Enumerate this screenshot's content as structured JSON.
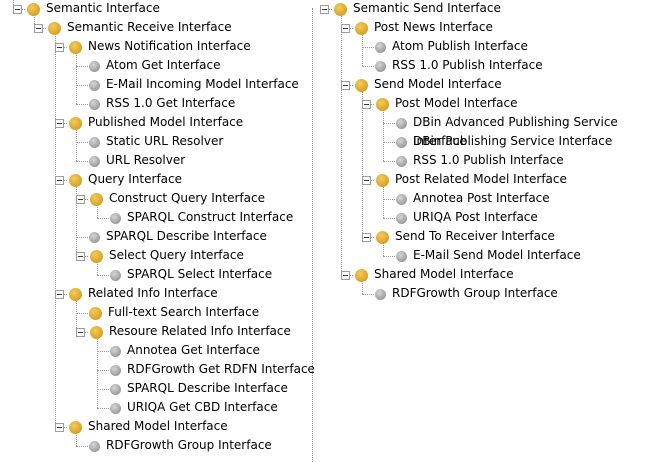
{
  "tree": {
    "left": {
      "label": "Semantic Interface",
      "children": [
        {
          "label": "Semantic Receive Interface",
          "children": [
            {
              "label": "News Notification Interface",
              "children": [
                {
                  "label": "Atom Get Interface"
                },
                {
                  "label": "E-Mail Incoming Model Interface"
                },
                {
                  "label": "RSS 1.0 Get Interface"
                }
              ]
            },
            {
              "label": "Published Model Interface",
              "children": [
                {
                  "label": "Static URL Resolver"
                },
                {
                  "label": "URL Resolver"
                }
              ]
            },
            {
              "label": "Query Interface",
              "children": [
                {
                  "label": "Construct Query Interface",
                  "children": [
                    {
                      "label": "SPARQL Construct Interface"
                    }
                  ]
                },
                {
                  "label": "SPARQL Describe Interface"
                },
                {
                  "label": "Select Query Interface",
                  "children": [
                    {
                      "label": "SPARQL Select Interface"
                    }
                  ]
                }
              ]
            },
            {
              "label": "Related Info Interface",
              "children": [
                {
                  "label": "Full-text Search Interface",
                  "icon": "branch"
                },
                {
                  "label": "Resoure Related Info Interface",
                  "children": [
                    {
                      "label": "Annotea Get Interface"
                    },
                    {
                      "label": "RDFGrowth Get RDFN Interface"
                    },
                    {
                      "label": "SPARQL Describe Interface"
                    },
                    {
                      "label": "URIQA Get CBD Interface"
                    }
                  ]
                }
              ]
            },
            {
              "label": "Shared Model Interface",
              "children": [
                {
                  "label": "RDFGrowth Group Interface"
                }
              ]
            }
          ]
        }
      ]
    },
    "right": {
      "label": "Semantic Send Interface",
      "children": [
        {
          "label": "Post News Interface",
          "children": [
            {
              "label": "Atom Publish Interface"
            },
            {
              "label": "RSS 1.0 Publish Interface"
            }
          ]
        },
        {
          "label": "Send Model Interface",
          "children": [
            {
              "label": "Post Model Interface",
              "children": [
                {
                  "label": "DBin Advanced Publishing Service Interface"
                },
                {
                  "label": "DBin Publishing Service Interface"
                },
                {
                  "label": "RSS 1.0 Publish Interface"
                }
              ]
            },
            {
              "label": "Post Related Model Interface",
              "children": [
                {
                  "label": "Annotea Post Interface"
                },
                {
                  "label": "URIQA Post Interface"
                }
              ]
            },
            {
              "label": "Send To Receiver Interface",
              "children": [
                {
                  "label": "E-Mail Send Model Interface"
                }
              ]
            }
          ]
        },
        {
          "label": "Shared Model Interface",
          "children": [
            {
              "label": "RDFGrowth Group Interface"
            }
          ]
        }
      ]
    }
  },
  "icons": {
    "branch": "gold-circle-icon",
    "leaf": "gray-circle-icon",
    "expander": "collapse-minus-icon"
  },
  "colors": {
    "branch_icon": "#d9a125",
    "leaf_icon": "#9c9c9c",
    "connector": "#9a9a9a"
  }
}
